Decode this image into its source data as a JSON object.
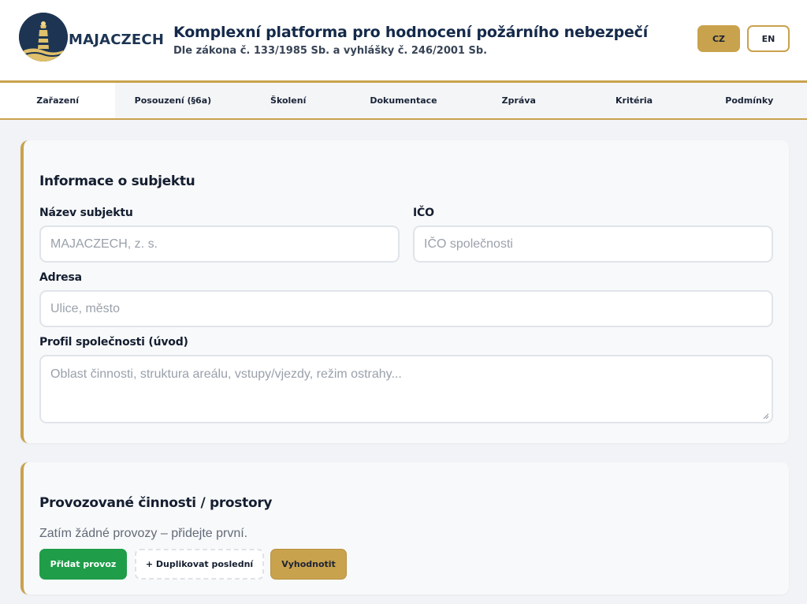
{
  "header": {
    "logo_text": "MAJACZECH",
    "title": "Komplexní platforma pro hodnocení požárního nebezpečí",
    "subtitle": "Dle zákona č. 133/1985 Sb. a vyhlášky č. 246/2001 Sb.",
    "lang_cz": "CZ",
    "lang_en": "EN"
  },
  "tabs": [
    {
      "label": "Zařazení",
      "active": true
    },
    {
      "label": "Posouzení (§6a)"
    },
    {
      "label": "Školení"
    },
    {
      "label": "Dokumentace"
    },
    {
      "label": "Zpráva"
    },
    {
      "label": "Kritéria"
    },
    {
      "label": "Podmínky"
    }
  ],
  "subject": {
    "heading": "Informace o subjektu",
    "name_label": "Název subjektu",
    "name_placeholder": "MAJACZECH, z. s.",
    "ico_label": "IČO",
    "ico_placeholder": "IČO společnosti",
    "address_label": "Adresa",
    "address_placeholder": "Ulice, město",
    "profile_label": "Profil společnosti (úvod)",
    "profile_placeholder": "Oblast činnosti, struktura areálu, vstupy/vjezdy, režim ostrahy..."
  },
  "operations": {
    "heading": "Provozované činnosti / prostory",
    "empty_text": "Zatím žádné provozy – přidejte první.",
    "add_button": "Přidat provoz",
    "duplicate_button": "+ Duplikovat poslední",
    "evaluate_button": "Vyhodnotit"
  },
  "colors": {
    "accent_gold": "#c9a24d",
    "navy": "#1d3553",
    "green": "#1f9d49"
  }
}
